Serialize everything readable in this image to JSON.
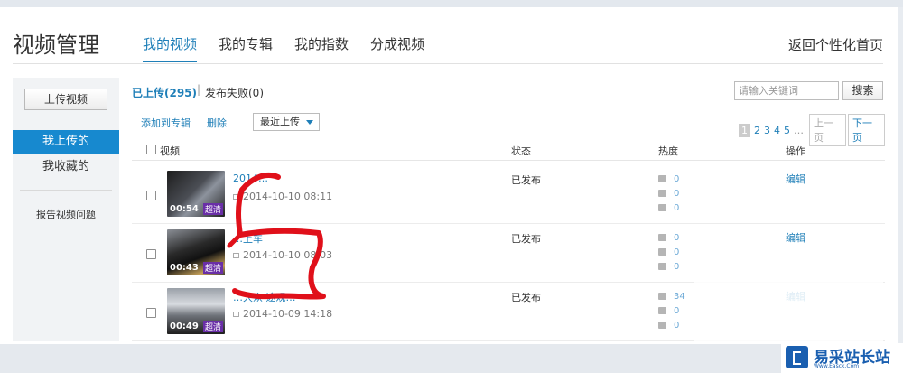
{
  "header": {
    "title": "视频管理",
    "tabs": [
      {
        "label": "我的视频"
      },
      {
        "label": "我的专辑"
      },
      {
        "label": "我的指数"
      },
      {
        "label": "分成视频"
      }
    ],
    "back_home": "返回个性化首页"
  },
  "sidebar": {
    "upload_button": "上传视频",
    "items": [
      {
        "label": "我上传的"
      },
      {
        "label": "我收藏的"
      }
    ],
    "report": "报告视频问题"
  },
  "filters": {
    "published": "已上传(295)",
    "separator": "|",
    "failed": "发布失败(0)"
  },
  "search": {
    "placeholder": "请输入关键词",
    "button": "搜索"
  },
  "toolbar": {
    "add_to_album": "添加到专辑",
    "delete": "删除",
    "sort_value": "最近上传"
  },
  "pager": {
    "pages": [
      "1",
      "2",
      "3",
      "4",
      "5"
    ],
    "ellipsis": "…",
    "prev": "上一页",
    "next": "下一页"
  },
  "table": {
    "headers": {
      "video": "视频",
      "status": "状态",
      "heat": "热度",
      "action": "操作"
    },
    "rows": [
      {
        "title": "2014…",
        "duration": "00:54",
        "quality": "超清",
        "date": "2014-10-10 08:11",
        "status": "已发布",
        "plays": "0",
        "comments": "0",
        "shares": "0",
        "action": "编辑"
      },
      {
        "title": "…上车",
        "duration": "00:43",
        "quality": "超清",
        "date": "2014-10-10 08:03",
        "status": "已发布",
        "plays": "0",
        "comments": "0",
        "shares": "0",
        "action": "编辑"
      },
      {
        "title": "…大众 途观…",
        "duration": "00:49",
        "quality": "超清",
        "date": "2014-10-09 14:18",
        "status": "已发布",
        "plays": "34",
        "comments": "0",
        "shares": "0",
        "action": "编辑"
      }
    ]
  },
  "watermark": {
    "title": "易采站长站",
    "subtitle": "Www.Easck.Com"
  },
  "colors": {
    "accent": "#1f7fb8",
    "active_nav": "#1789cf",
    "annotation": "#e0101a"
  }
}
